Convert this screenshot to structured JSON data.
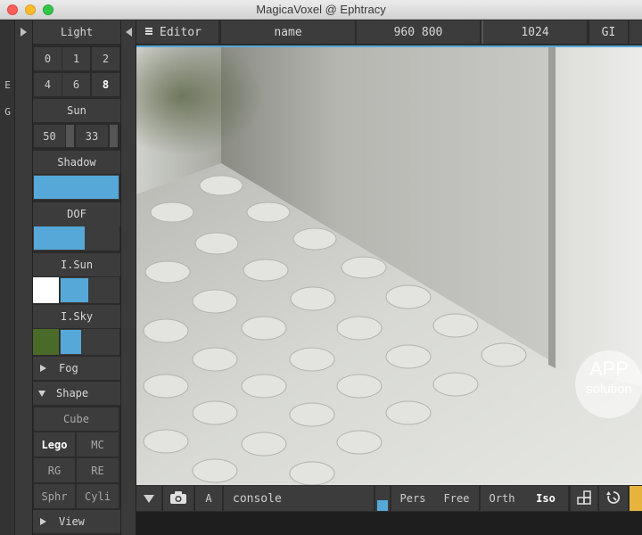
{
  "window": {
    "title": "MagicaVoxel @ Ephtracy"
  },
  "strip": {
    "e_label": "E",
    "g_label": "G"
  },
  "light_panel": {
    "header": "Light",
    "samples_row1": [
      "0",
      "1",
      "2"
    ],
    "samples_row2": [
      "4",
      "6",
      "8"
    ],
    "selected_sample": "8",
    "sun_label": "Sun",
    "sun_values": [
      "50",
      "33"
    ],
    "shadow_label": "Shadow",
    "shadow_fill": 1.0,
    "dof_label": "DOF",
    "dof_fill": 0.6,
    "isun_label": "I.Sun",
    "isun_color": "#ffffff",
    "isky_label": "I.Sky",
    "isky_color": "#4a6a2a",
    "fog_label": "Fog",
    "shape_label": "Shape",
    "shape_items": {
      "cube": "Cube",
      "lego": "Lego",
      "mc": "MC",
      "rg": "RG",
      "re": "RE",
      "sphr": "Sphr",
      "cyli": "Cyli"
    },
    "selected_shape": "Lego",
    "view_label": "View"
  },
  "toolbar": {
    "editor_label": "Editor",
    "name_label": "name",
    "size_value": "960 800",
    "samples_value": "1024",
    "gi_label": "GI"
  },
  "bottombar": {
    "a_label": "A",
    "console_label": "console",
    "pers_label": "Pers",
    "free_label": "Free",
    "orth_label": "Orth",
    "iso_label": "Iso"
  },
  "watermark": {
    "line1": "APP",
    "line2": "solution"
  },
  "colors": {
    "accent": "#55a8d8",
    "panel_bg": "#3c3c3c",
    "yellow": "#e6b43c"
  }
}
